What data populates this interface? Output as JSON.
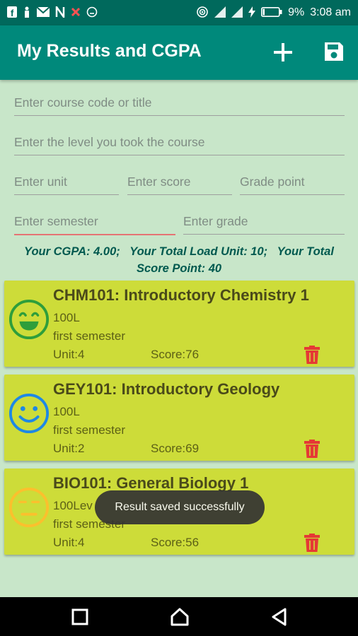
{
  "status_bar": {
    "battery": "9%",
    "time": "3:08 am",
    "left_icons": [
      "facebook-icon",
      "person-icon",
      "mail-icon",
      "n-icon",
      "x-icon",
      "smiley-icon"
    ],
    "right_icons": [
      "hotspot-icon",
      "signal-icon",
      "signal2-icon",
      "charging-icon",
      "battery-icon"
    ]
  },
  "app_bar": {
    "title": "My Results and CGPA",
    "background": "#00897b",
    "actions": [
      "add-icon",
      "save-icon"
    ]
  },
  "form": {
    "course_placeholder": "Enter course code or title",
    "level_placeholder": "Enter the level you took the course",
    "unit_placeholder": "Enter unit",
    "score_placeholder": "Enter score",
    "grade_point_placeholder": "Grade point",
    "semester_placeholder": "Enter semester",
    "grade_placeholder": "Enter grade"
  },
  "summary": {
    "line1": "Your CGPA: 4.00;   Your Total Load Unit: 10;   Your Total",
    "line2": "Score Point: 40"
  },
  "courses": [
    {
      "title": "CHM101: Introductory Chemistry 1",
      "level": "100L",
      "semester": "first semester",
      "unit": "Unit:4",
      "score": "Score:76",
      "face": "grin",
      "color": "#2e9e3b"
    },
    {
      "title": "GEY101: Introductory Geology",
      "level": "100L",
      "semester": "first semester",
      "unit": "Unit:2",
      "score": "Score:69",
      "face": "smile",
      "color": "#1e88e5"
    },
    {
      "title": "BIO101: General Biology 1",
      "level": "100Lev",
      "semester": "first semester",
      "unit": "Unit:4",
      "score": "Score:56",
      "face": "neutral",
      "color": "#fbc02d"
    }
  ],
  "toast": "Result saved successfully",
  "colors": {
    "card": "#cddc39",
    "delete": "#e53935",
    "summary_text": "#00594f"
  }
}
